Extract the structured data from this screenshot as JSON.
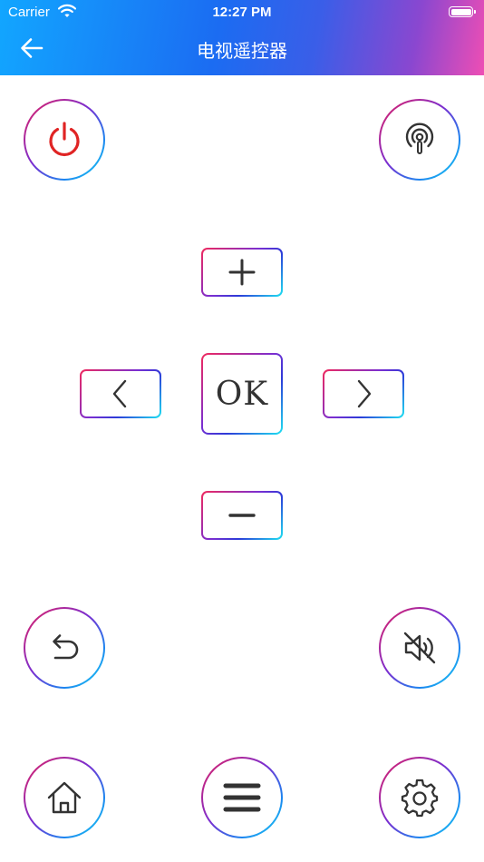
{
  "status_bar": {
    "carrier": "Carrier",
    "time": "12:27 PM"
  },
  "nav": {
    "title": "电视遥控器",
    "back_icon": "arrow-left-icon"
  },
  "remote": {
    "ok_label": "OK",
    "accent_colors": [
      "#e6205e",
      "#7a2ed1",
      "#1a86f0",
      "#1ee0f2"
    ],
    "power_color": "#e02424",
    "icons": {
      "power": "power-icon",
      "signal": "podcast-signal-icon",
      "volume_up": "plus-icon",
      "left": "chevron-left-icon",
      "right": "chevron-right-icon",
      "volume_down": "minus-icon",
      "back": "undo-arrow-icon",
      "mute": "mute-speaker-icon",
      "home": "home-icon",
      "menu": "menu-icon",
      "settings": "gear-icon"
    }
  }
}
